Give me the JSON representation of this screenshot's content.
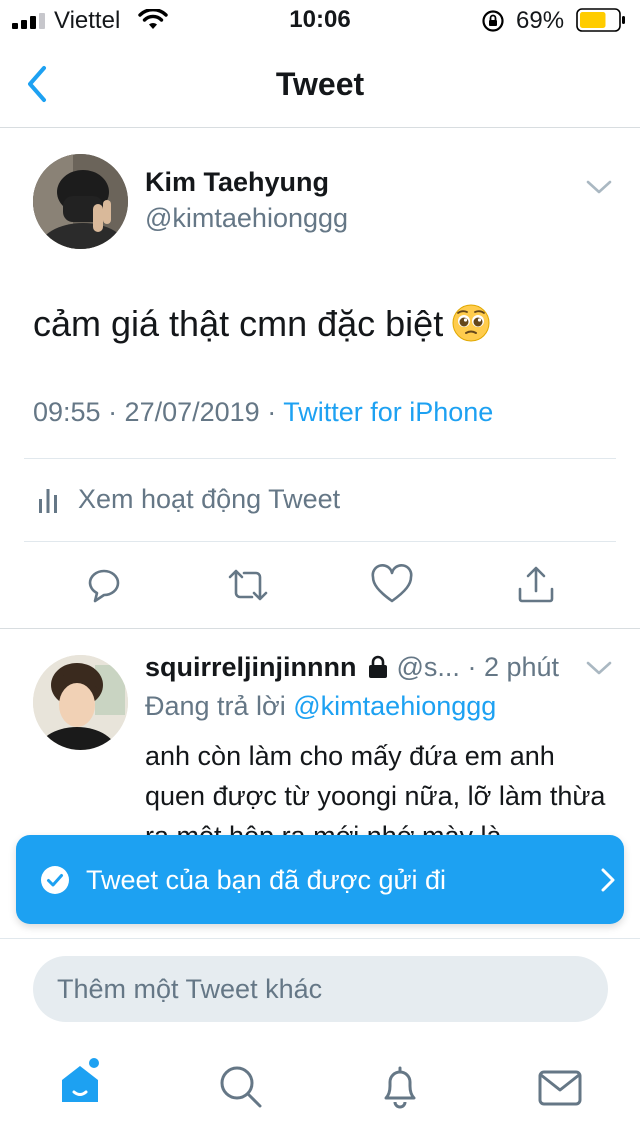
{
  "status_bar": {
    "carrier": "Viettel",
    "time": "10:06",
    "battery_percent": "69%",
    "battery_level": 0.69,
    "battery_color": "#ffcc00"
  },
  "nav": {
    "title": "Tweet",
    "back_icon": "chevron-left-icon"
  },
  "tweet": {
    "author_name": "Kim Taehyung",
    "author_handle": "@kimtaehionggg",
    "text": "cảm giá thật cmn đặc biệt",
    "emoji": "pleading-face-emoji",
    "timestamp": "09:55 · 27/07/2019 · ",
    "source": "Twitter for iPhone",
    "activity_label": "Xem hoạt động Tweet",
    "actions": [
      "reply-icon",
      "retweet-icon",
      "like-icon",
      "share-icon"
    ]
  },
  "reply": {
    "name": "squirreljinjinnnn",
    "handle": "@s...",
    "time": "· 2 phút",
    "replying_prefix": "Đang trả lời ",
    "replying_to": "@kimtaehionggg",
    "text": "anh còn làm cho mấy đứa em anh quen được từ yoongi nữa, lỡ làm thừa ra một hộp ra mới nhớ mày là"
  },
  "toast": {
    "message": "Tweet của bạn đã được gửi đi"
  },
  "compose": {
    "placeholder": "Thêm một Tweet khác"
  },
  "tabs": [
    "home-icon",
    "search-icon",
    "notifications-icon",
    "messages-icon"
  ],
  "colors": {
    "accent": "#1da1f2",
    "secondary_text": "#657786",
    "toast_bg": "#1da1f2"
  }
}
